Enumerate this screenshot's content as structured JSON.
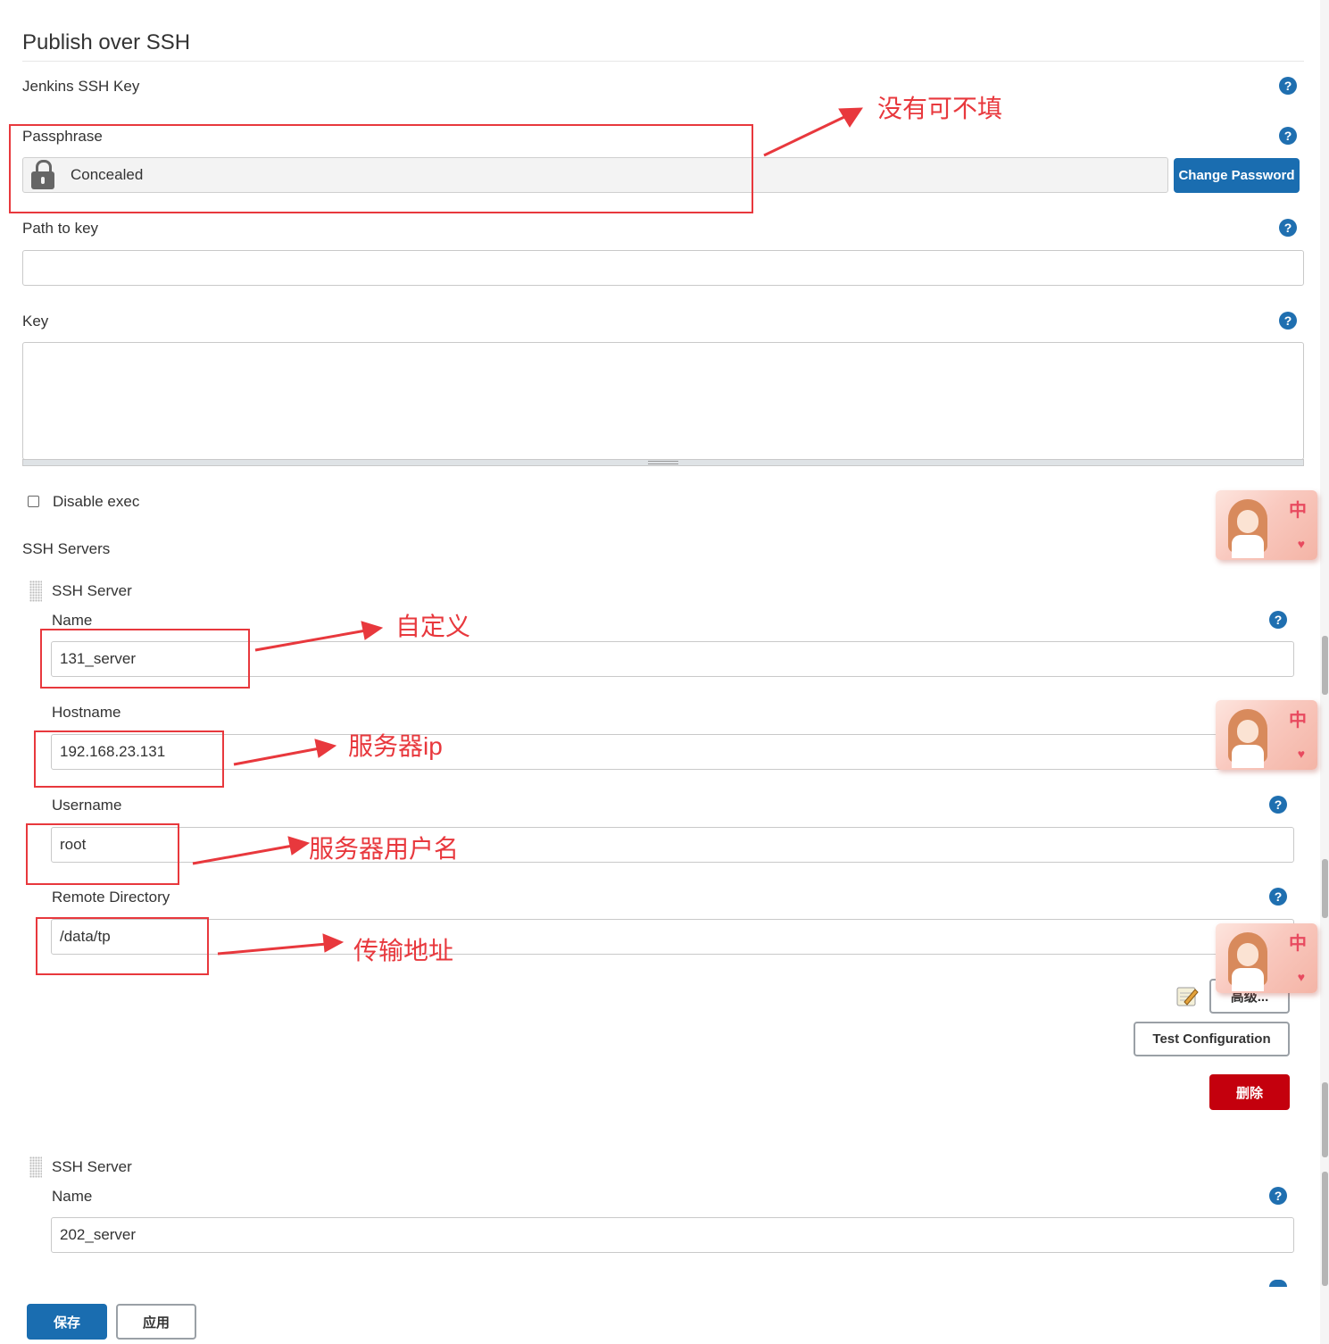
{
  "section": {
    "title": "Publish over SSH"
  },
  "jenkins_ssh_key": {
    "label": "Jenkins SSH Key"
  },
  "passphrase": {
    "label": "Passphrase",
    "value": "Concealed",
    "change_button": "Change Password"
  },
  "path_to_key": {
    "label": "Path to key",
    "value": ""
  },
  "key": {
    "label": "Key",
    "value": ""
  },
  "disable_exec": {
    "label": "Disable exec",
    "checked": false
  },
  "ssh_servers": {
    "label": "SSH Servers",
    "servers": [
      {
        "header": "SSH Server",
        "name_label": "Name",
        "name": "131_server",
        "hostname_label": "Hostname",
        "hostname": "192.168.23.131",
        "username_label": "Username",
        "username": "root",
        "remote_dir_label": "Remote Directory",
        "remote_dir": "/data/tp",
        "advanced_button": "高级...",
        "test_button": "Test Configuration",
        "delete_button": "删除"
      },
      {
        "header": "SSH Server",
        "name_label": "Name",
        "name": "202_server"
      }
    ]
  },
  "footer": {
    "save": "保存",
    "apply": "应用"
  },
  "annotations": {
    "passphrase_note": "没有可不填",
    "name_note": "自定义",
    "hostname_note": "服务器ip",
    "username_note": "服务器用户名",
    "remote_dir_note": "传输地址",
    "color": "#e8383d"
  },
  "widget": {
    "text": "中"
  },
  "icons": {
    "help": "help-icon",
    "lock": "lock-icon",
    "drag": "drag-handle-icon",
    "notepad": "notepad-icon"
  },
  "colors": {
    "primary": "#1a6db0",
    "danger": "#c4000d",
    "help": "#1f6fb0"
  }
}
